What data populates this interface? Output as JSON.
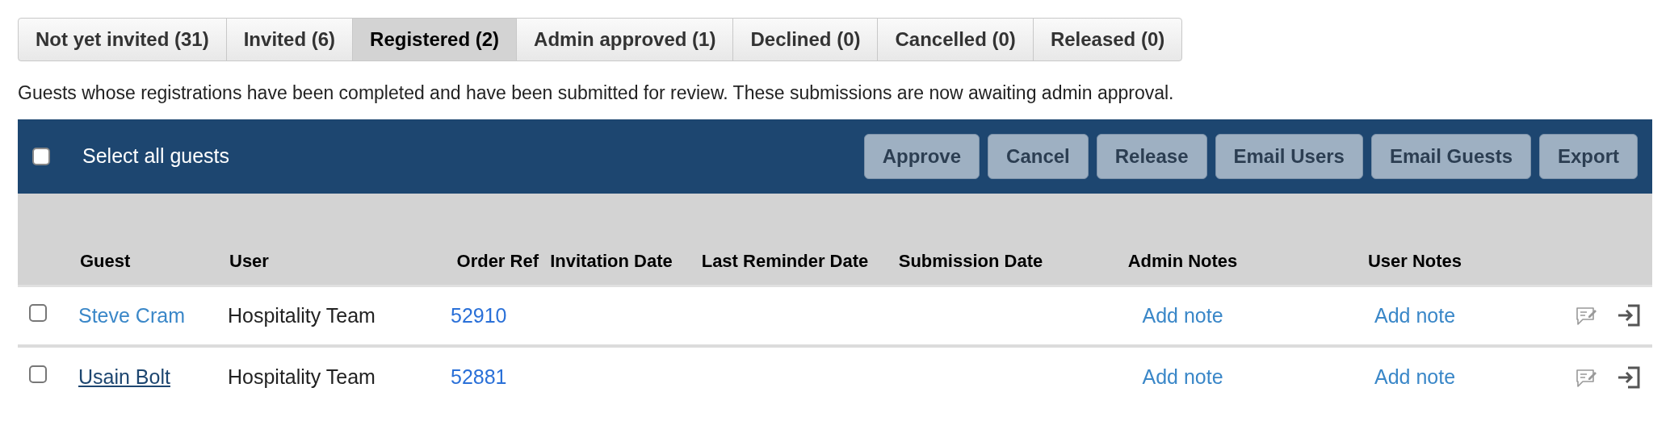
{
  "tabs": [
    {
      "label": "Not yet invited (31)",
      "selected": false
    },
    {
      "label": "Invited (6)",
      "selected": false
    },
    {
      "label": "Registered (2)",
      "selected": true
    },
    {
      "label": "Admin approved (1)",
      "selected": false
    },
    {
      "label": "Declined (0)",
      "selected": false
    },
    {
      "label": "Cancelled (0)",
      "selected": false
    },
    {
      "label": "Released (0)",
      "selected": false
    }
  ],
  "description": "Guests whose registrations have been completed and have been submitted for review. These submissions are now awaiting admin approval.",
  "toolbar": {
    "select_all": {
      "label": "Select all guests",
      "checked": false
    },
    "buttons": [
      "Approve",
      "Cancel",
      "Release",
      "Email Users",
      "Email Guests",
      "Export"
    ]
  },
  "table": {
    "columns": [
      "Guest",
      "User",
      "Order Ref",
      "Invitation Date",
      "Last Reminder Date",
      "Submission Date",
      "Admin Notes",
      "User Notes"
    ],
    "rows": [
      {
        "checked": false,
        "guest": "Steve Cram",
        "hovered": false,
        "user": "Hospitality Team",
        "order_ref": "52910",
        "admin_notes": "Add note",
        "user_notes": "Add note"
      },
      {
        "checked": false,
        "guest": "Usain Bolt",
        "hovered": true,
        "user": "Hospitality Team",
        "order_ref": "52881",
        "admin_notes": "Add note",
        "user_notes": "Add note"
      }
    ]
  }
}
